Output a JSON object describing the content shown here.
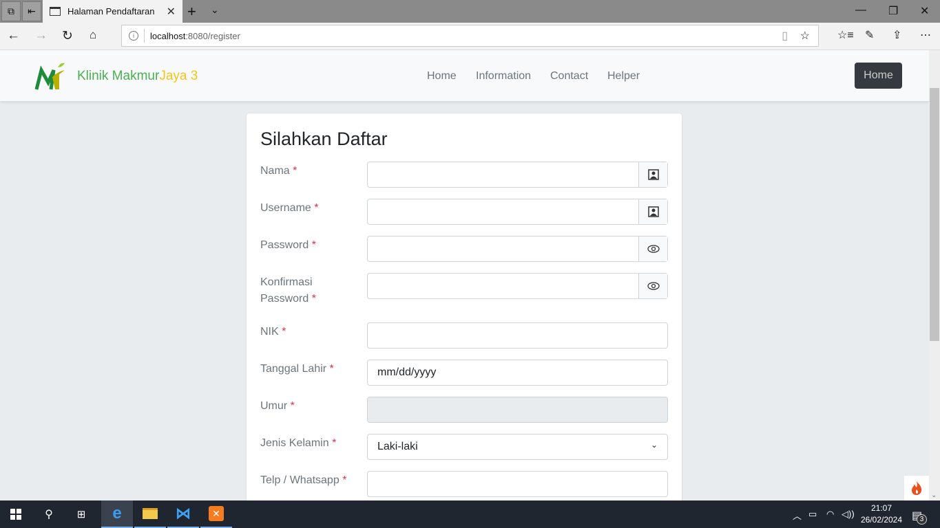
{
  "browser": {
    "tab_title": "Halaman Pendaftaran",
    "url_host": "localhost",
    "url_path": ":8080/register"
  },
  "brand": {
    "name_green": "Klinik Makmur",
    "name_yellow": "Jaya 3"
  },
  "nav": {
    "items": [
      "Home",
      "Information",
      "Contact",
      "Helper"
    ],
    "button": "Home"
  },
  "form": {
    "title": "Silahkan Daftar",
    "fields": [
      {
        "label": "Nama",
        "req": "*",
        "value": "",
        "icon": "person-badge-icon"
      },
      {
        "label": "Username",
        "req": "*",
        "value": "",
        "icon": "person-badge-icon"
      },
      {
        "label": "Password",
        "req": "*",
        "value": "",
        "icon": "eye-icon"
      },
      {
        "label": "Konfirmasi Password",
        "req": "*",
        "value": "",
        "icon": "eye-icon"
      },
      {
        "label": "NIK",
        "req": "*",
        "value": ""
      },
      {
        "label": "Tanggal Lahir",
        "req": "*",
        "value": "mm/dd/yyyy"
      },
      {
        "label": "Umur",
        "req": "*",
        "value": "",
        "disabled": true
      },
      {
        "label": "Jenis Kelamin",
        "req": "*",
        "value": "Laki-laki"
      },
      {
        "label": "Telp / Whatsapp",
        "req": "*",
        "value": ""
      }
    ]
  },
  "taskbar": {
    "time": "21:07",
    "date": "26/02/2024",
    "notifications": "3"
  },
  "colors": {
    "brand_green": "#4caf50",
    "brand_yellow": "#f5c518",
    "required": "#dc3545",
    "dark_button": "#343a40"
  }
}
